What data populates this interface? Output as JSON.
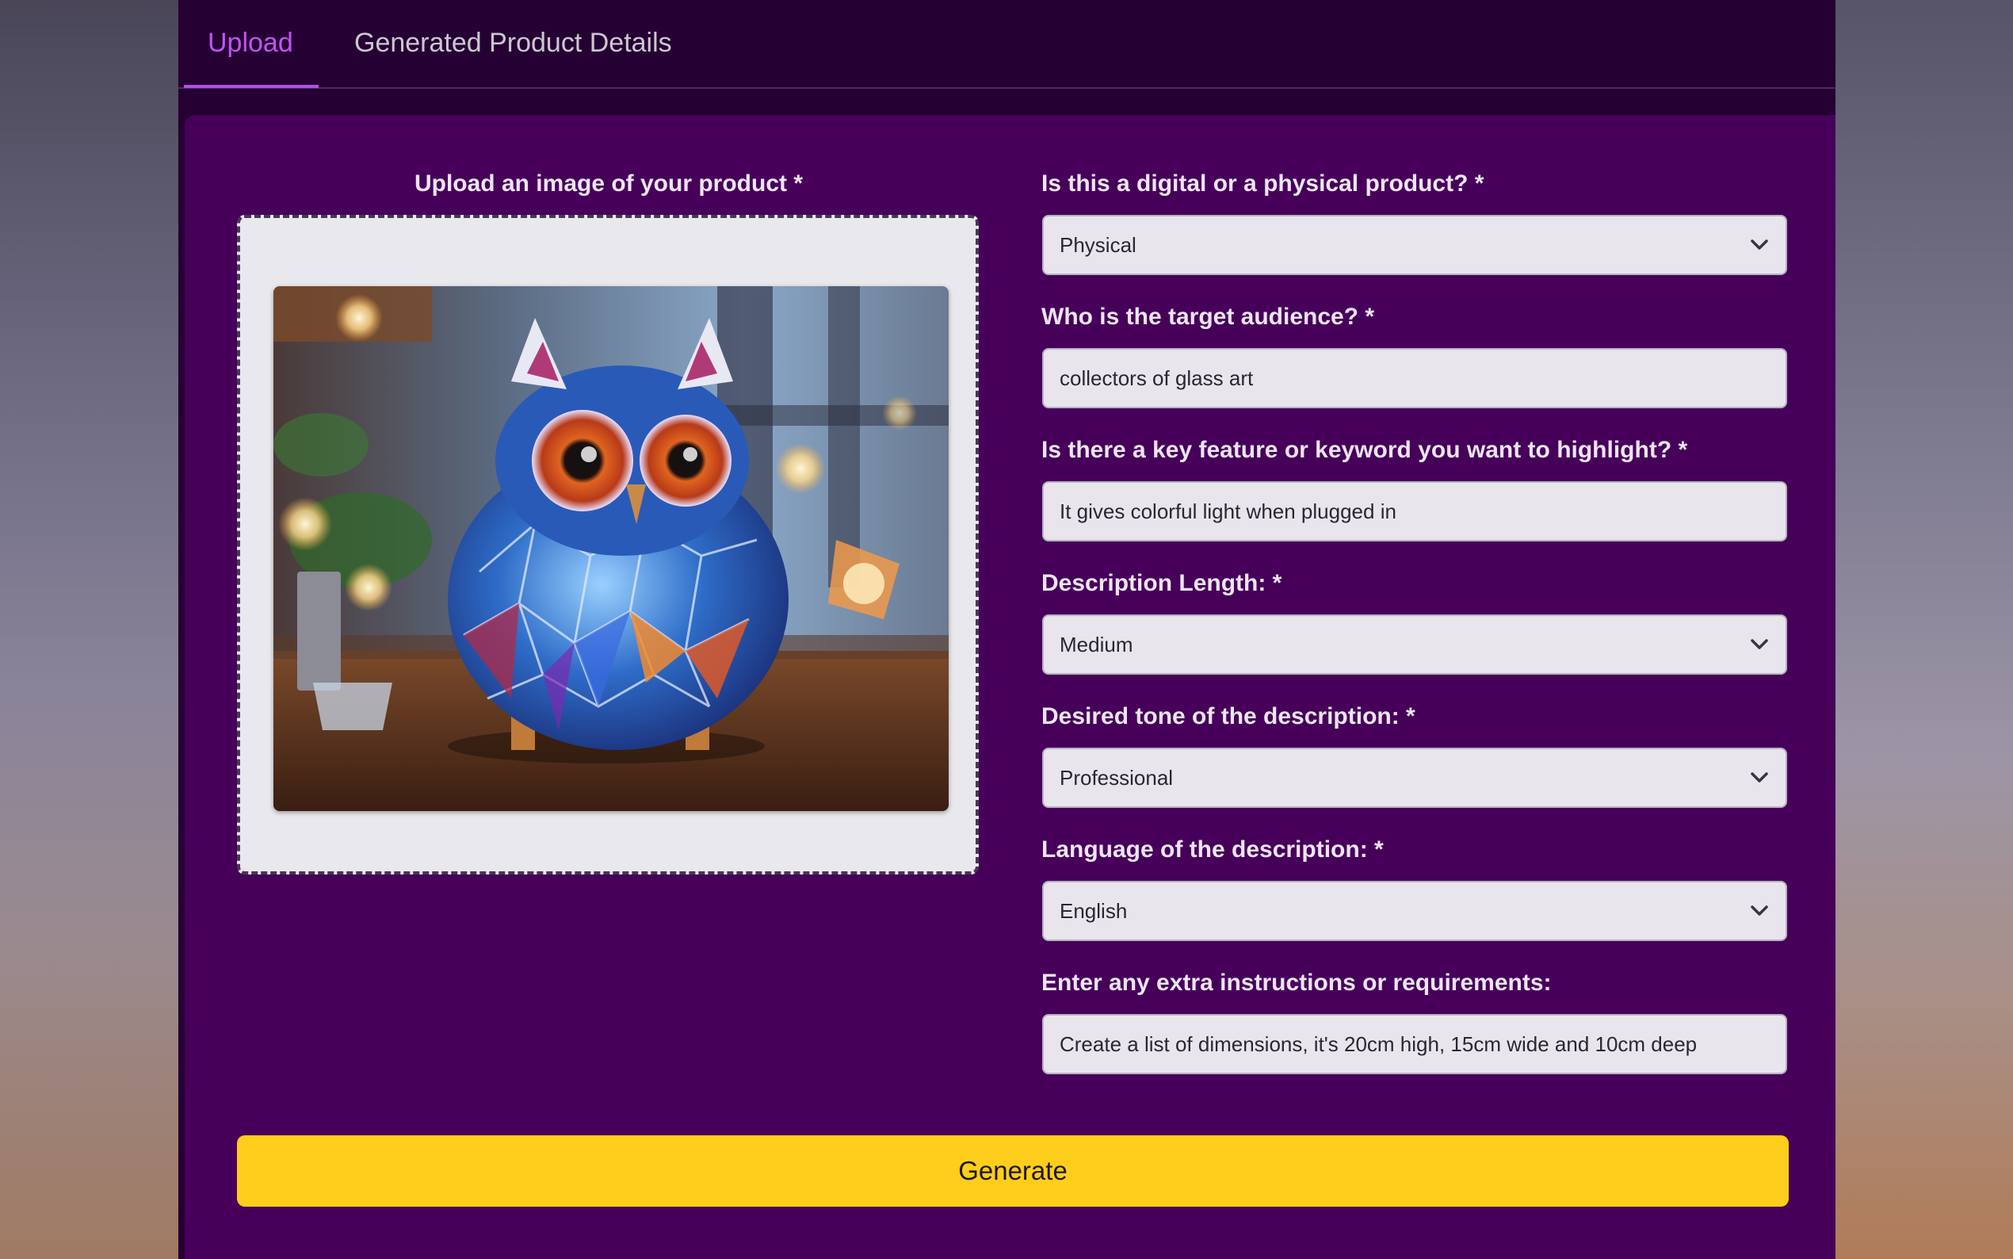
{
  "tabs": [
    {
      "label": "Upload",
      "active": true
    },
    {
      "label": "Generated Product Details",
      "active": false
    }
  ],
  "upload": {
    "label": "Upload an image of your product *",
    "image_alt": "stained glass owl figurine"
  },
  "form": {
    "product_type": {
      "label": "Is this a digital or a physical product? *",
      "value": "Physical"
    },
    "target_audience": {
      "label": "Who is the target audience? *",
      "value": "collectors of glass art"
    },
    "key_feature": {
      "label": "Is there a key feature or keyword you want to highlight? *",
      "value": "It gives colorful light when plugged in"
    },
    "description_length": {
      "label": "Description Length: *",
      "value": "Medium"
    },
    "tone": {
      "label": "Desired tone of the description: *",
      "value": "Professional"
    },
    "language": {
      "label": "Language of the description: *",
      "value": "English"
    },
    "extra_instructions": {
      "label": "Enter any extra instructions or requirements:",
      "value": "Create a list of dimensions, it's 20cm high, 15cm wide and 10cm deep"
    }
  },
  "generate_label": "Generate",
  "colors": {
    "app_bg": "#250033",
    "panel_bg": "#46005a",
    "active_tab": "#c054f2",
    "generate_button": "#ffcd1c"
  },
  "icons": {
    "select_chevron": "chevron-down-icon"
  }
}
